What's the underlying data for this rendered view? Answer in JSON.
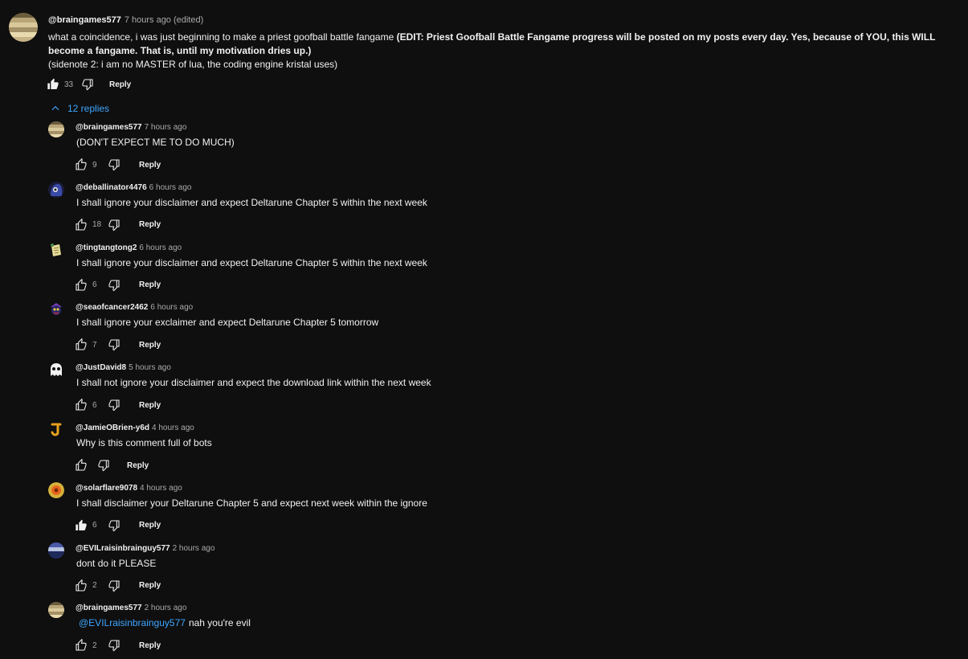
{
  "top_comment": {
    "author": "@braingames577",
    "time": "7 hours ago",
    "edited": "(edited)",
    "body_part1": "what a coincidence, i was just beginning to make a priest goofball battle fangame ",
    "body_bold": "(EDIT: Priest Goofball Battle Fangame progress will be posted on my posts every day. Yes, because of YOU, this WILL become a fangame. That is, until my motivation dries up.)",
    "body_line3": "(sidenote 2: i am no MASTER of lua, the coding engine kristal uses)",
    "likes": "33",
    "liked": true,
    "reply_label": "Reply"
  },
  "replies_toggle": {
    "label": "12 replies",
    "icon": "chevron-up-icon",
    "color": "#3ea6ff"
  },
  "replies": [
    {
      "author": "@braingames577",
      "time": "7 hours ago",
      "mention": "",
      "text": "(DON'T EXPECT ME TO DO MUCH)",
      "likes": "9",
      "liked": false,
      "reply_label": "Reply",
      "avatar": "stripes"
    },
    {
      "author": "@deballinator4476",
      "time": "6 hours ago",
      "mention": "",
      "text": "I shall ignore your disclaimer and expect Deltarune Chapter 5 within the next week",
      "likes": "18",
      "liked": false,
      "reply_label": "Reply",
      "avatar": "blue-hood"
    },
    {
      "author": "@tingtangtong2",
      "time": "6 hours ago",
      "mention": "",
      "text": "I shall ignore your disclaimer and expect Deltarune Chapter 5 within the next week",
      "likes": "6",
      "liked": false,
      "reply_label": "Reply",
      "avatar": "scroll"
    },
    {
      "author": "@seaofcancer2462",
      "time": "6 hours ago",
      "mention": "",
      "text": "I shall ignore your exclaimer and expect Deltarune Chapter 5 tomorrow",
      "likes": "7",
      "liked": false,
      "reply_label": "Reply",
      "avatar": "jester"
    },
    {
      "author": "@JustDavid8",
      "time": "5 hours ago",
      "mention": "",
      "text": "I shall not ignore your disclaimer and expect the download link within the next week",
      "likes": "6",
      "liked": false,
      "reply_label": "Reply",
      "avatar": "ghost"
    },
    {
      "author": "@JamieOBrien-y6d",
      "time": "4 hours ago",
      "mention": "",
      "text": "Why is this comment full of bots",
      "likes": "",
      "liked": false,
      "reply_label": "Reply",
      "avatar": "letter-j"
    },
    {
      "author": "@solarflare9078",
      "time": "4 hours ago",
      "mention": "",
      "text": "I shall disclaimer your Deltarune Chapter 5 and expect next week within the ignore",
      "likes": "6",
      "liked": true,
      "reply_label": "Reply",
      "avatar": "flower"
    },
    {
      "author": "@EVILraisinbrainguy577",
      "time": "2 hours ago",
      "mention": "",
      "text": "dont do it PLEASE",
      "likes": "2",
      "liked": false,
      "reply_label": "Reply",
      "avatar": "ocean"
    },
    {
      "author": "@braingames577",
      "time": "2 hours ago",
      "mention": "@EVILraisinbrainguy577",
      "text": "nah you're evil",
      "likes": "2",
      "liked": false,
      "reply_label": "Reply",
      "avatar": "stripes"
    }
  ]
}
